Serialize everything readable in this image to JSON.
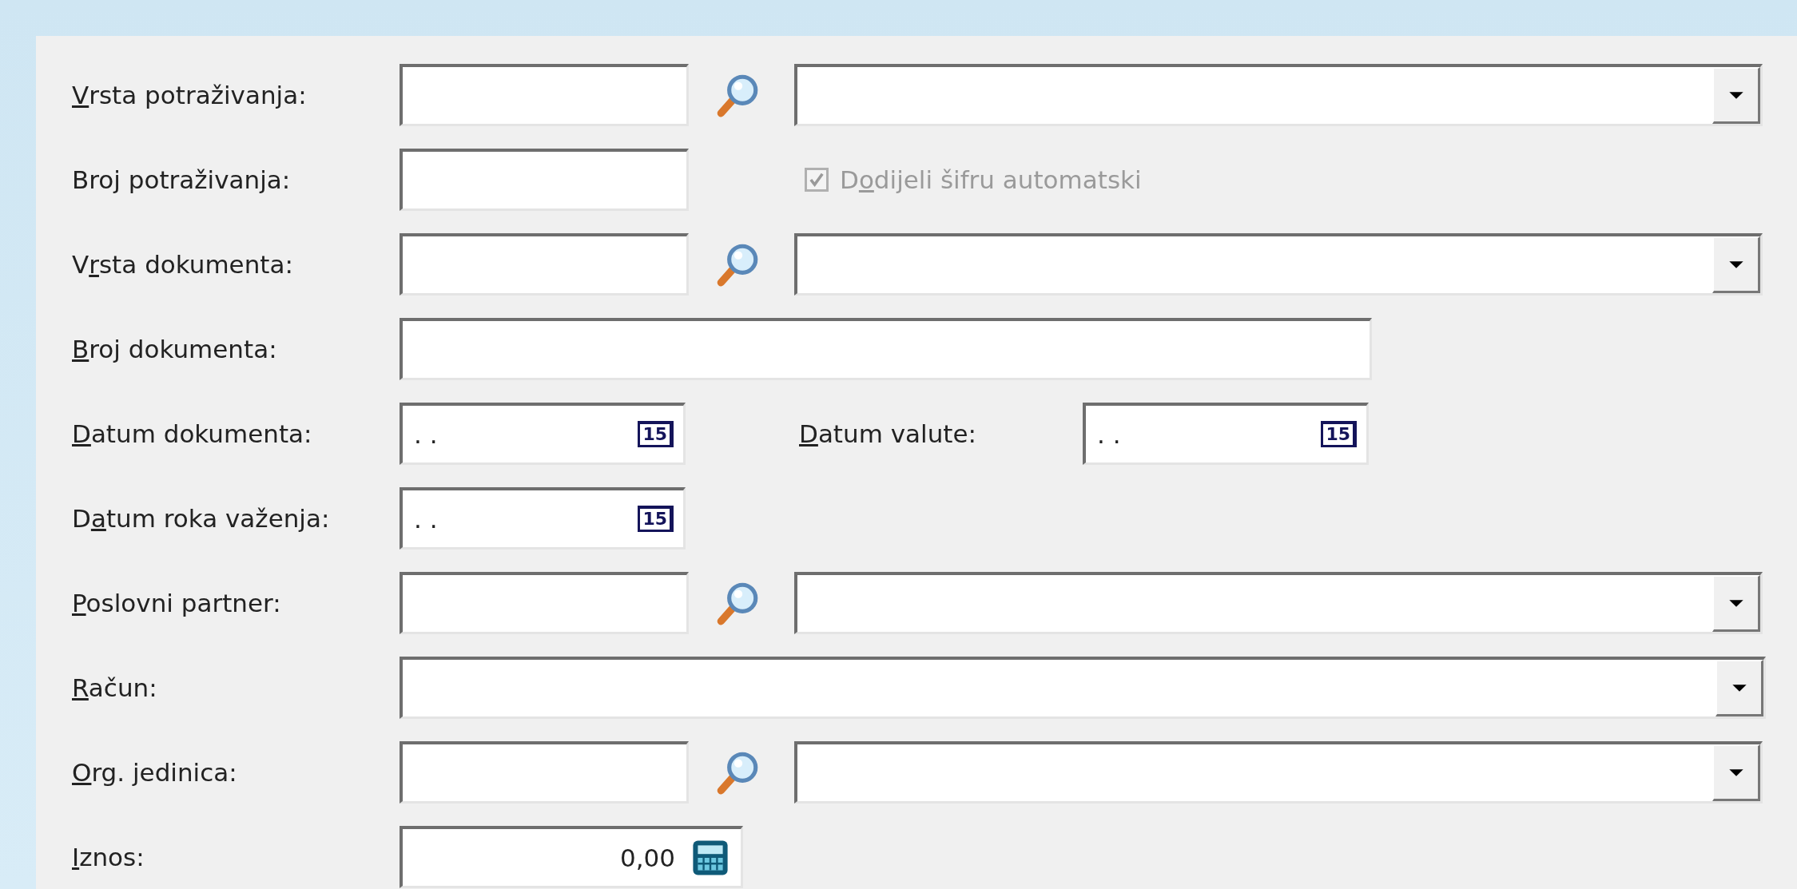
{
  "rows": [
    {
      "kind": "lookup",
      "label": {
        "key": "V",
        "post": "rsta potraživanja:"
      }
    },
    {
      "kind": "code_checkbox",
      "label": {
        "pre": "Broj potraživanja:"
      },
      "checkbox": {
        "label": {
          "pre": "D",
          "key": "o",
          "post": "dijeli šifru automatski"
        },
        "checked": true,
        "disabled": true
      }
    },
    {
      "kind": "lookup",
      "label": {
        "pre": "V",
        "key": "r",
        "post": "sta dokumenta:"
      }
    },
    {
      "kind": "text",
      "label": {
        "key": "B",
        "post": "roj dokumenta:"
      }
    },
    {
      "kind": "date_pair",
      "label": {
        "key": "D",
        "post": "atum dokumenta:"
      },
      "value": ". .",
      "icon_text": "15",
      "second": {
        "label": {
          "key": "D",
          "post": "atum valute:"
        },
        "value": ". .",
        "icon_text": "15"
      }
    },
    {
      "kind": "date",
      "label": {
        "pre": "D",
        "key": "a",
        "post": "tum roka važenja:"
      },
      "value": ". .",
      "icon_text": "15"
    },
    {
      "kind": "lookup",
      "label": {
        "key": "P",
        "post": "oslovni partner:"
      }
    },
    {
      "kind": "combo",
      "label": {
        "key": "R",
        "post": "ačun:"
      }
    },
    {
      "kind": "lookup",
      "label": {
        "key": "O",
        "post": "rg. jedinica:"
      }
    },
    {
      "kind": "amount",
      "label": {
        "key": "I",
        "post": "znos:"
      },
      "value": "0,00"
    }
  ]
}
